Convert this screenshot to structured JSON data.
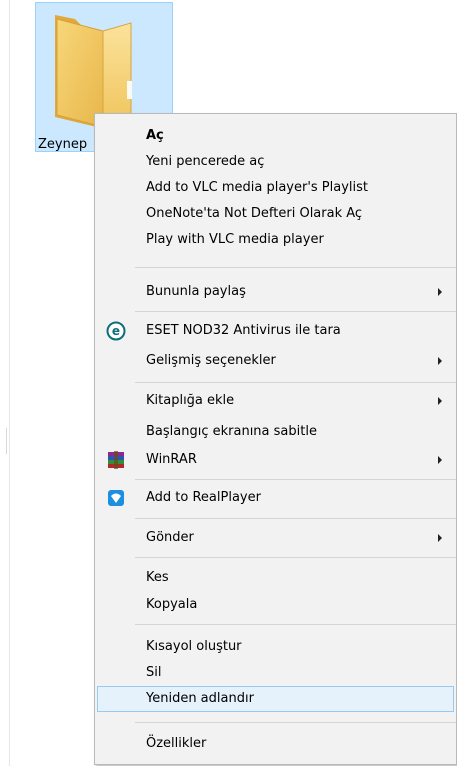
{
  "folder": {
    "name": "Zeynep"
  },
  "menu": {
    "open": "Aç",
    "open_new_window": "Yeni pencerede aç",
    "vlc_playlist": "Add to VLC media player's Playlist",
    "onenote": "OneNote'ta Not Defteri Olarak Aç",
    "vlc_play": "Play with VLC media player",
    "share_with": "Bununla paylaş",
    "eset_scan": "ESET NOD32 Antivirus ile tara",
    "advanced": "Gelişmiş seçenekler",
    "add_library": "Kitaplığa ekle",
    "pin_start": "Başlangıç ekranına sabitle",
    "winrar": "WinRAR",
    "realplayer": "Add to RealPlayer",
    "send_to": "Gönder",
    "cut": "Kes",
    "copy": "Kopyala",
    "create_shortcut": "Kısayol oluştur",
    "delete": "Sil",
    "rename": "Yeniden adlandır",
    "properties": "Özellikler"
  },
  "icons": {
    "folder": "folder-icon",
    "eset": "eset-icon",
    "winrar": "winrar-icon",
    "realplayer": "realplayer-icon",
    "submenu": "chevron-right-icon"
  },
  "colors": {
    "selection_bg": "#cce8ff",
    "menu_bg": "#f2f2f2",
    "highlight_bg": "#e5f1fb",
    "highlight_border": "#99c9ef"
  }
}
